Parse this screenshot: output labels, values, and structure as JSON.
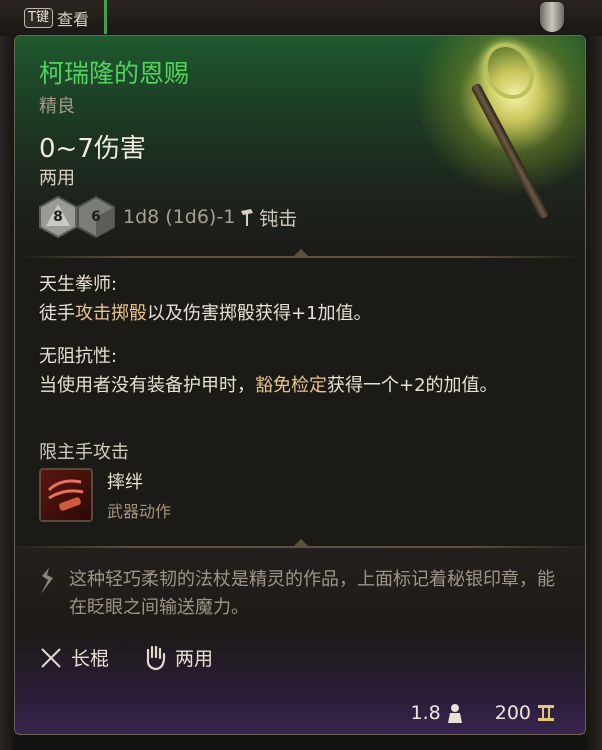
{
  "background": {
    "hint_key": "T键",
    "hint_label": "查看"
  },
  "item": {
    "name": "柯瑞隆的恩赐",
    "rarity": "精良",
    "damage": "0~7伤害",
    "handedness": "两用",
    "dice": [
      "8",
      "6"
    ],
    "dice_formula": "1d8 (1d6)-1",
    "damage_type": "钝击"
  },
  "passives": [
    {
      "name": "天生拳师:",
      "text_before": "徒手",
      "highlight": "攻击掷骰",
      "text_after": "以及伤害掷骰获得+1加值。"
    },
    {
      "name": "无阻抗性:",
      "text_before": "当使用者没有装备护甲时，",
      "highlight": "豁免检定",
      "text_after": "获得一个+2的加值。"
    }
  ],
  "restriction": "限主手攻击",
  "action": {
    "name": "摔绊",
    "type": "武器动作"
  },
  "flavor": "这种轻巧柔韧的法杖是精灵的作品，上面标记着秘银印章，能在眨眼之间输送魔力。",
  "properties": [
    {
      "icon": "crossed-staves-icon",
      "label": "长棍"
    },
    {
      "icon": "hand-icon",
      "label": "两用"
    }
  ],
  "stats": {
    "weight": "1.8",
    "price": "200"
  },
  "colors": {
    "name": "#52d25f",
    "highlight": "#e6c48a",
    "flavor": "#9c9588"
  }
}
